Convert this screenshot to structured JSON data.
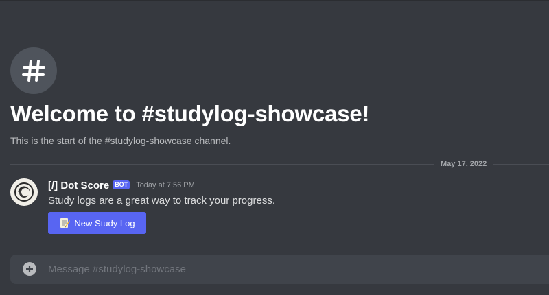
{
  "channel": {
    "icon": "hash-icon",
    "welcome_title": "Welcome to #studylog-showcase!",
    "welcome_subtitle": "This is the start of the #studylog-showcase channel."
  },
  "divider": {
    "date": "May 17, 2022"
  },
  "message": {
    "avatar": "bot-avatar",
    "username": "[/] Dot Score",
    "bot_tag": "BOT",
    "timestamp": "Today at 7:56 PM",
    "content": "Study logs are a great way to track your progress.",
    "button": {
      "icon": "memo-icon",
      "label": "New Study Log"
    }
  },
  "composer": {
    "add_icon": "plus-circle-icon",
    "placeholder": "Message #studylog-showcase"
  },
  "colors": {
    "background": "#36393f",
    "blurple": "#5865f2",
    "composer": "#40444b"
  }
}
